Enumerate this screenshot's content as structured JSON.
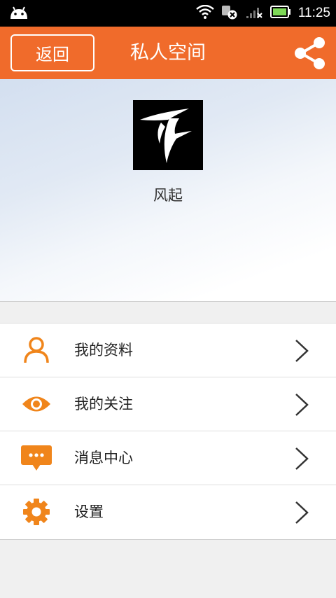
{
  "status_bar": {
    "time": "11:25",
    "icons": [
      "android-icon",
      "wifi-icon",
      "data-off-icon",
      "signal-icon",
      "battery-icon"
    ]
  },
  "titlebar": {
    "back_label": "返回",
    "title": "私人空间",
    "share_icon": "share-icon"
  },
  "profile": {
    "username": "风起"
  },
  "menu": {
    "items": [
      {
        "label": "我的资料",
        "icon": "person-icon"
      },
      {
        "label": "我的关注",
        "icon": "eye-icon"
      },
      {
        "label": "消息中心",
        "icon": "message-icon"
      },
      {
        "label": "设置",
        "icon": "gear-icon"
      }
    ]
  },
  "colors": {
    "accent": "#f06b2b",
    "icon_orange": "#f0851b",
    "status_bar": "#000000"
  }
}
